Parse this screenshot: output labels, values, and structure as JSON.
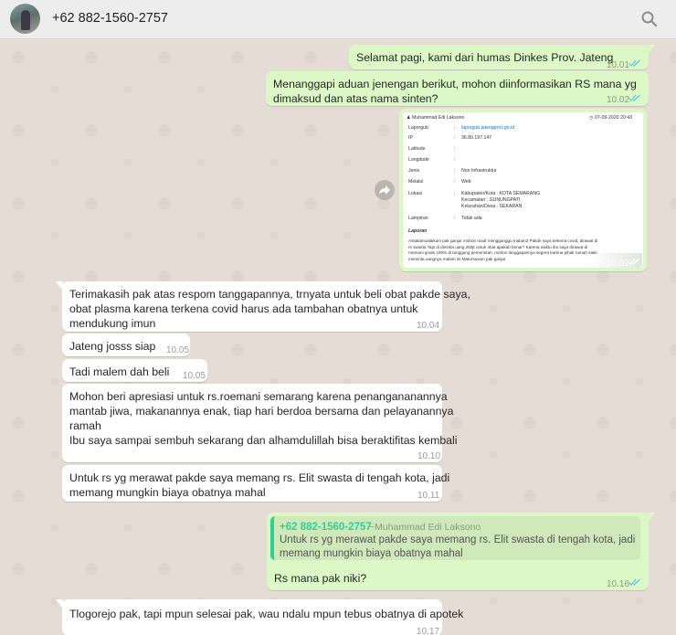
{
  "header": {
    "contact_name": "+62 882-1560-2757",
    "search_icon": "search-icon",
    "avatar": "contact-avatar"
  },
  "messages": [
    {
      "dir": "out",
      "text": "Selamat pagi, kami dari humas Dinkes Prov. Jateng",
      "time": "10.01",
      "status": "read"
    },
    {
      "dir": "out",
      "text": "Menanggapi aduan jenengan berikut, mohon diinformasikan RS mana yg\ndimaksud dan atas nama sinten?",
      "time": "10.02",
      "status": "read"
    },
    {
      "dir": "out",
      "type": "image",
      "time": "10.02",
      "status": "read",
      "image": {
        "author": "Muhammad Edi Laksono",
        "date": "07-09-2020 20:43",
        "fields": [
          {
            "label": "Laporgub",
            "value": "laporgub.jatengprov.go.id"
          },
          {
            "label": "IP",
            "value": "36.80.197.147"
          },
          {
            "label": "Latitude",
            "value": ""
          },
          {
            "label": "Longitude",
            "value": ""
          },
          {
            "label": "Jenis",
            "value": "Non Infrastruktur"
          },
          {
            "label": "Melalui",
            "value": "Web"
          },
          {
            "label": "Lokasi",
            "value": "Kabupaten/Kota : KOTA SEMARANG\nKecamatan : GUNUNGPATI\nKelurahan/Desa : SEKARAN"
          },
          {
            "label": "Lampiran",
            "value": "Tidak ada"
          }
        ],
        "report_title": "Laporan",
        "report_text": "Assalamualaikum pak ganjar mohon maaf mengganggu malam2 Pakde saya terkena covid, dirawat di\nrs swasta Tapi di diminta uang 250jt untuk obat apakah benar? Karena waktu ibu saya dirawat di\nroemani gratis 100% di tanggung pemerintah, mohon tanggapannya segera karena pihak rumah sakit\nmeminta uangnya malam ini Matursuwun pak ganjar"
      }
    },
    {
      "dir": "in",
      "text": "Terimakasih pak atas respom tanggapannya, trnyata untuk beli obat pakde saya,\nobat plasma karena terkena covid harus ada tambahan obatnya untuk\nmendukung imun",
      "time": "10.04"
    },
    {
      "dir": "in",
      "text": "Jateng josss siap",
      "time": "10.05"
    },
    {
      "dir": "in",
      "text": "Tadi malem dah beli",
      "time": "10.05"
    },
    {
      "dir": "in",
      "text": "Mohon beri apresiasi untuk rs.roemani semarang karena penangananannya\nmantab jiwa, makanannya enak, tiap hari berdoa bersama dan pelayanannya\nramah\nIbu saya sampai sembuh sekarang dan alhamdulillah bisa beraktifitas kembali",
      "time": "10.10"
    },
    {
      "dir": "in",
      "text": "Untuk rs yg merawat pakde saya memang rs. Elit swasta di tengah kota, jadi\nmemang mungkin biaya obatnya mahal",
      "time": "10.11"
    },
    {
      "dir": "out",
      "type": "reply",
      "time": "10.16",
      "status": "read",
      "quote": {
        "name": "+62 882-1560-2757",
        "pushname": "~Muhammad Edi Laksono",
        "text": "Untuk rs yg merawat pakde saya memang rs. Elit swasta di tengah kota, jadi\nmemang mungkin biaya obatnya mahal"
      },
      "text": "Rs mana pak niki?"
    },
    {
      "dir": "in",
      "text": "Tlogorejo pak, tapi mpun selesai pak, wau ndalu mpun tebus obatnya di apotek",
      "time": "10.17"
    }
  ],
  "colors": {
    "outgoing": "#dcf8c6",
    "incoming": "#ffffff",
    "background": "#e5ddd5",
    "read_ticks": "#4fc3f7",
    "quote_accent": "#35cd96"
  }
}
